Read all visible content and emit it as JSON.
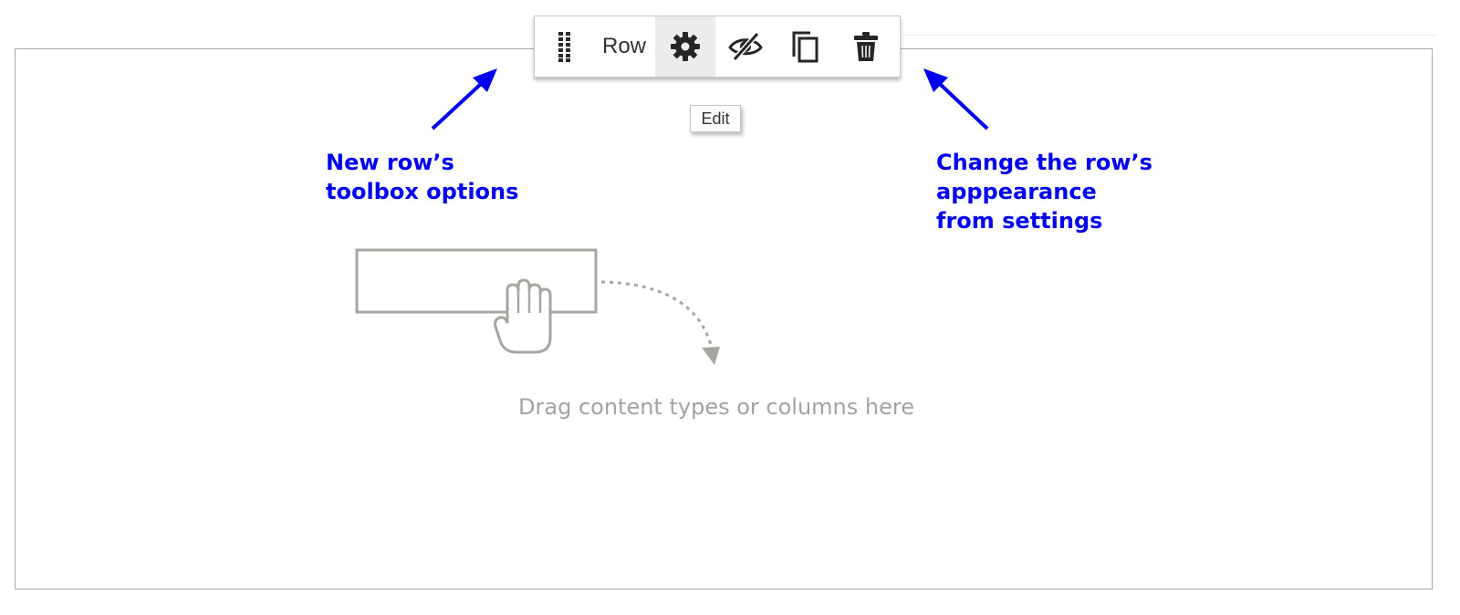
{
  "toolbar": {
    "row_label": "Row",
    "tooltip": "Edit",
    "buttons": [
      {
        "name": "move-handle",
        "icon": "drag-handle-icon"
      },
      {
        "name": "settings",
        "icon": "gear-icon"
      },
      {
        "name": "hide",
        "icon": "eye-slash-icon"
      },
      {
        "name": "duplicate",
        "icon": "copy-icon"
      },
      {
        "name": "remove",
        "icon": "trash-icon"
      }
    ]
  },
  "annotations": {
    "left": "New row’s\ntoolbox options",
    "right": "Change the row’s\napppearance\nfrom settings",
    "color": "#0000ee"
  },
  "dropzone": {
    "text": "Drag content types or columns here",
    "illustration": "drag-hand-icon"
  }
}
